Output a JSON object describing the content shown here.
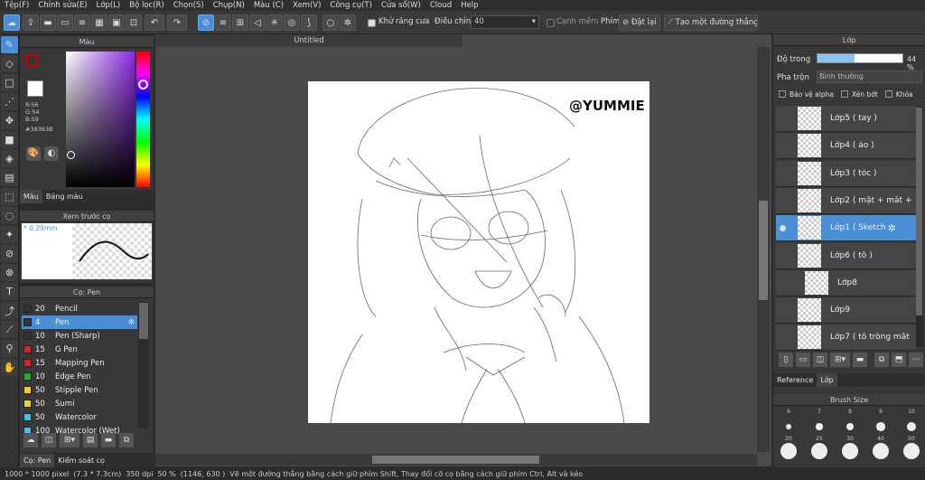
{
  "menu": [
    "Tệp(F)",
    "Chỉnh sửa(E)",
    "Lớp(L)",
    "Bộ lọc(R)",
    "Chọn(S)",
    "Chụp(N)",
    "Màu (C)",
    "Xem(V)",
    "Công cụ(T)",
    "Cửa sổ(W)",
    "Cloud",
    "Help"
  ],
  "toolbar": {
    "antialias_label": "Khử răng cưa",
    "adjust_label": "Điều chỉnh",
    "adjust_value": "40",
    "edge_label": "Cạnh mềm",
    "pen_label": "Phím",
    "reset_label": "Đặt lại",
    "straight_label": "Tạo một đường thẳng"
  },
  "color_panel": {
    "title": "Màu",
    "r": "R:56",
    "g": "G:54",
    "b": "B:59",
    "hex": "#38363B",
    "tab_color": "Màu",
    "tab_palette": "Bảng màu"
  },
  "brush_preview": {
    "title": "Xem trước cọ",
    "size": "* 0.29mm"
  },
  "brush_panel": {
    "title": "Cọ: Pen",
    "brushes": [
      {
        "size": "20",
        "name": "Pencil",
        "color": "#333333"
      },
      {
        "size": "4",
        "name": "Pen",
        "color": "#333333"
      },
      {
        "size": "10",
        "name": "Pen (Sharp)",
        "color": "#333333"
      },
      {
        "size": "15",
        "name": "G Pen",
        "color": "#e02020"
      },
      {
        "size": "15",
        "name": "Mapping Pen",
        "color": "#e02020"
      },
      {
        "size": "10",
        "name": "Edge Pen",
        "color": "#20b020"
      },
      {
        "size": "50",
        "name": "Stipple Pen",
        "color": "#f0d020"
      },
      {
        "size": "50",
        "name": "Sumi",
        "color": "#f0d020"
      },
      {
        "size": "50",
        "name": "Watercolor",
        "color": "#40c0f0"
      },
      {
        "size": "100",
        "name": "Watercolor (Wet)",
        "color": "#40c0f0"
      }
    ],
    "tab_brush": "Cọ: Pen",
    "tab_control": "Kiểm soát cọ"
  },
  "canvas": {
    "tab_title": "Untitled",
    "watermark": "@YUMMIE"
  },
  "layer_panel": {
    "title": "Lớp",
    "opacity_label": "Độ trong",
    "opacity_value": "44 %",
    "opacity": 0.44,
    "blend_label": "Pha trộn",
    "blend_value": "Bình thường",
    "protect_alpha": "Bảo vệ alpha",
    "clipping": "Xén bớt",
    "lock": "Khóa",
    "layers": [
      {
        "name": "Lớp5 ( tay )"
      },
      {
        "name": "Lớp4 ( áo )"
      },
      {
        "name": "Lớp3 ( tóc )"
      },
      {
        "name": "Lớp2 ( mặt + mắt +"
      },
      {
        "name": "Lớp1 ( Sketch"
      },
      {
        "name": "Lớp6 ( tô )"
      },
      {
        "name": "Lớp8"
      },
      {
        "name": "Lớp9"
      },
      {
        "name": "Lớp7 ( tô tròng mắt"
      }
    ],
    "tab_reference": "Reference",
    "tab_layer": "Lớp"
  },
  "brush_size_panel": {
    "title": "Brush Size",
    "row1": [
      "6",
      "7",
      "8",
      "9",
      "10"
    ],
    "row2": [
      "20",
      "25",
      "30",
      "40",
      "50"
    ]
  },
  "status": {
    "size": "1000 * 1000 pixel",
    "cm": "(7.3 * 7.3cm)",
    "dpi": "350 dpi",
    "zoom": "50 %",
    "coords": "(1146, 630 )",
    "hint": "Vẽ một đường thẳng bằng cách giữ phím Shift, Thay đổi cỡ cọ bằng cách giữ phím Ctrl, Alt và kéo"
  }
}
